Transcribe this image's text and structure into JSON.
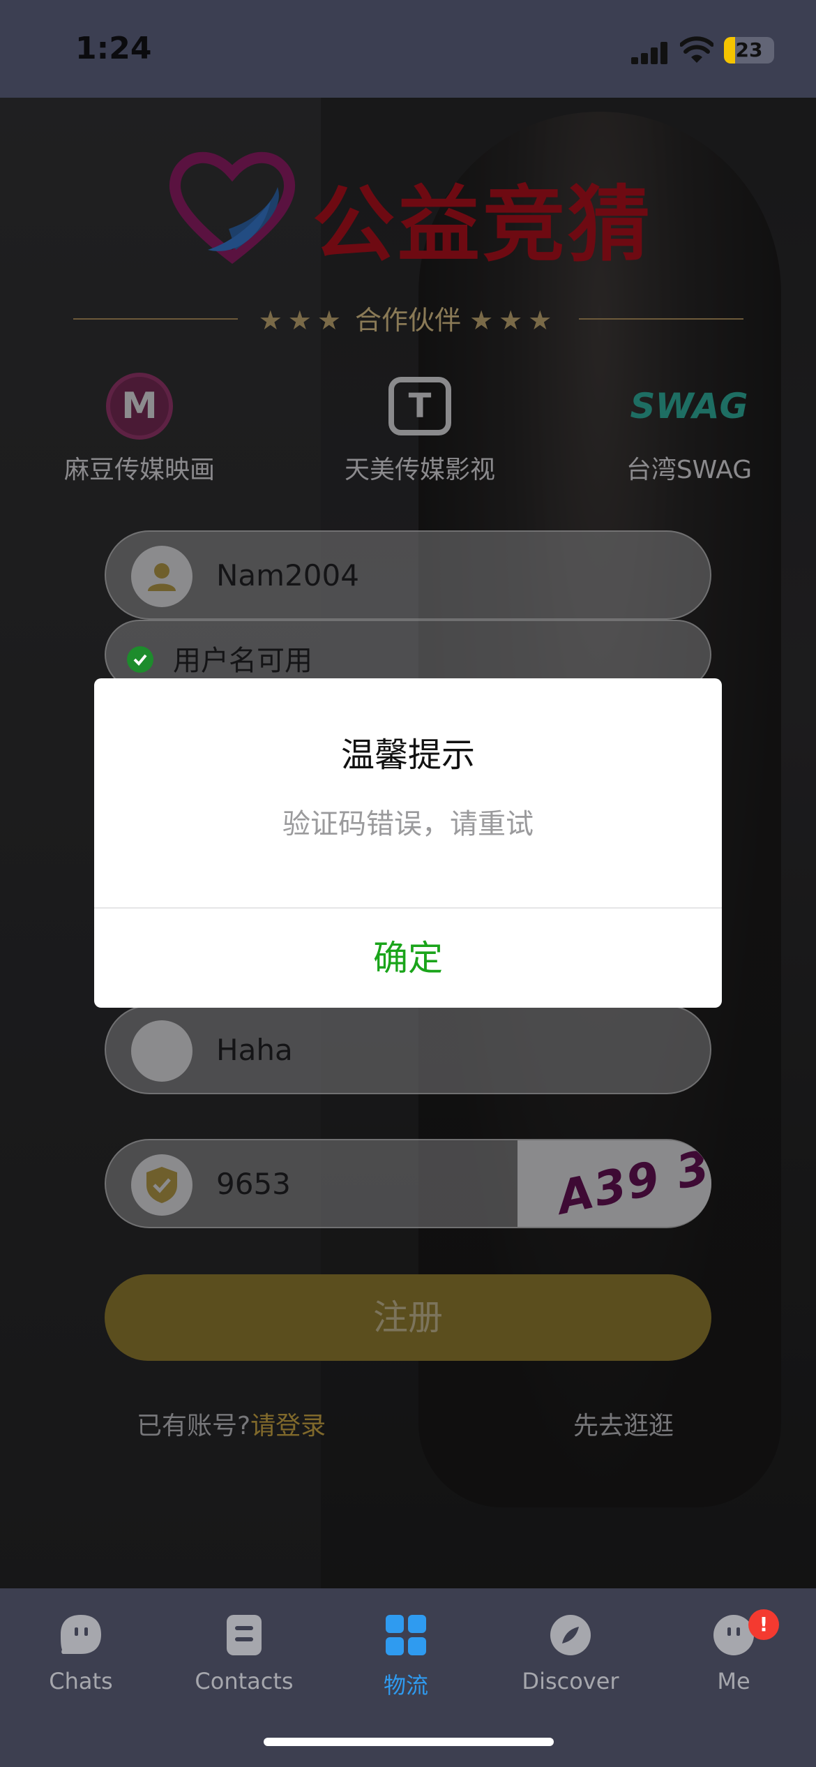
{
  "status_bar": {
    "time": "1:24",
    "battery": "23"
  },
  "brand": {
    "logo_text": "公益竞猜"
  },
  "partners": {
    "title": "合作伙伴",
    "stars_left": "★★★",
    "stars_right": "★★★",
    "items": [
      {
        "name": "麻豆传媒映画",
        "icon": "madou-logo-icon",
        "icon_text": "M"
      },
      {
        "name": "天美传媒影视",
        "icon": "tianmei-logo-icon",
        "icon_text": "T"
      },
      {
        "name": "台湾SWAG",
        "icon": "swag-logo-icon",
        "icon_text": "SWAG"
      }
    ]
  },
  "form": {
    "username_value": "Nam2004",
    "username_hint": "用户名可用",
    "nickname_value": "Haha",
    "captcha_value": "9653",
    "captcha_image_text": "A39 3",
    "register_label": "注册",
    "have_account": "已有账号?",
    "login_link": "请登录",
    "browse_link": "先去逛逛"
  },
  "dialog": {
    "title": "温馨提示",
    "message": "验证码错误，请重试",
    "confirm": "确定"
  },
  "tabbar": {
    "items": [
      {
        "label": "Chats",
        "icon": "chat-icon"
      },
      {
        "label": "Contacts",
        "icon": "contacts-icon"
      },
      {
        "label": "物流",
        "icon": "grid-icon"
      },
      {
        "label": "Discover",
        "icon": "compass-icon"
      },
      {
        "label": "Me",
        "icon": "me-icon"
      }
    ],
    "active_index": 2,
    "me_badge": "!"
  },
  "colors": {
    "accent_green": "#1aa41a",
    "tab_active": "#2f9bf0",
    "badge_red": "#f43a30"
  }
}
